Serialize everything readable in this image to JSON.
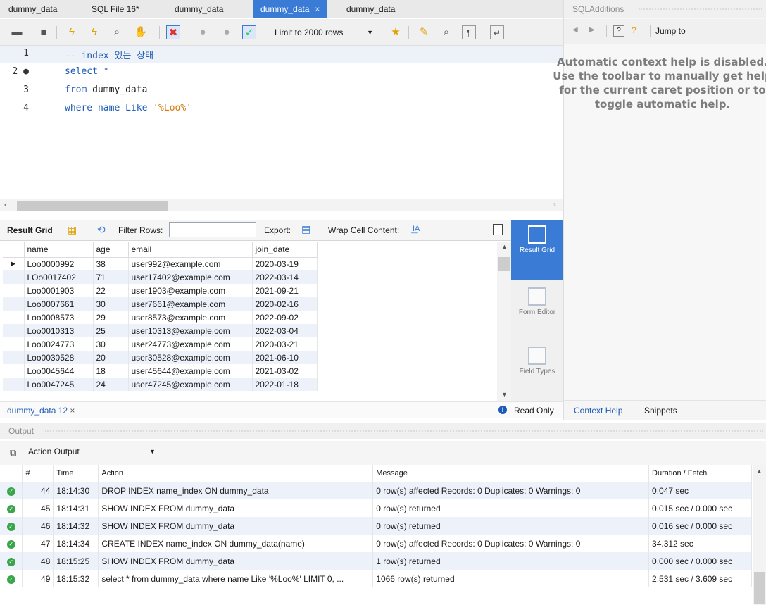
{
  "editor_tabs": [
    {
      "label": "dummy_data"
    },
    {
      "label": "SQL File 16*"
    },
    {
      "label": "dummy_data"
    },
    {
      "label": "dummy_data",
      "active": true
    },
    {
      "label": "dummy_data"
    }
  ],
  "toolbar": {
    "limit_label": "Limit to 2000 rows"
  },
  "editor": {
    "lines": [
      {
        "num": "1",
        "segments": [
          {
            "t": "-- index 있는 상태",
            "c": "cm"
          }
        ]
      },
      {
        "num": "2 ●",
        "segments": [
          {
            "t": "select *",
            "c": "kw"
          }
        ]
      },
      {
        "num": "3",
        "segments": [
          {
            "t": "from ",
            "c": "kw"
          },
          {
            "t": "dummy_data",
            "c": "plain"
          }
        ]
      },
      {
        "num": "4",
        "segments": [
          {
            "t": "where name Like ",
            "c": "kw"
          },
          {
            "t": "'%Loo%'",
            "c": "str"
          }
        ]
      }
    ]
  },
  "result_toolbar": {
    "result_grid_label": "Result Grid",
    "filter_label": "Filter Rows:",
    "filter_value": "",
    "export_label": "Export:",
    "wrap_label": "Wrap Cell Content:"
  },
  "result_grid": {
    "columns": [
      "name",
      "age",
      "email",
      "join_date"
    ],
    "rows": [
      [
        "Loo0000992",
        "38",
        "user992@example.com",
        "2020-03-19"
      ],
      [
        "LOo0017402",
        "71",
        "user17402@example.com",
        "2022-03-14"
      ],
      [
        "Loo0001903",
        "22",
        "user1903@example.com",
        "2021-09-21"
      ],
      [
        "Loo0007661",
        "30",
        "user7661@example.com",
        "2020-02-16"
      ],
      [
        "Loo0008573",
        "29",
        "user8573@example.com",
        "2022-09-02"
      ],
      [
        "Loo0010313",
        "25",
        "user10313@example.com",
        "2022-03-04"
      ],
      [
        "Loo0024773",
        "30",
        "user24773@example.com",
        "2020-03-21"
      ],
      [
        "Loo0030528",
        "20",
        "user30528@example.com",
        "2021-06-10"
      ],
      [
        "Loo0045644",
        "18",
        "user45644@example.com",
        "2021-03-02"
      ],
      [
        "Loo0047245",
        "24",
        "user47245@example.com",
        "2022-01-18"
      ]
    ]
  },
  "side_tools": [
    {
      "label": "Result Grid",
      "selected": true
    },
    {
      "label": "Form Editor"
    },
    {
      "label": "Field Types"
    }
  ],
  "result_status": {
    "tab_label": "dummy_data 12",
    "read_only": "Read Only"
  },
  "right_panel": {
    "title": "SQLAdditions",
    "jump_to": "Jump to",
    "help_text": "Automatic context help is disabled. Use the toolbar to manually get help for the current caret position or to toggle automatic help.",
    "tabs": [
      "Context Help",
      "Snippets"
    ]
  },
  "output": {
    "title": "Output",
    "selector": "Action Output",
    "columns": [
      "#",
      "Time",
      "Action",
      "Message",
      "Duration / Fetch"
    ],
    "rows": [
      [
        "44",
        "18:14:30",
        "DROP INDEX name_index ON dummy_data",
        "0 row(s) affected Records: 0  Duplicates: 0  Warnings: 0",
        "0.047 sec"
      ],
      [
        "45",
        "18:14:31",
        "SHOW INDEX FROM dummy_data",
        "0 row(s) returned",
        "0.015 sec / 0.000 sec"
      ],
      [
        "46",
        "18:14:32",
        "SHOW INDEX FROM dummy_data",
        "0 row(s) returned",
        "0.016 sec / 0.000 sec"
      ],
      [
        "47",
        "18:14:34",
        "CREATE INDEX name_index ON dummy_data(name)",
        "0 row(s) affected Records: 0  Duplicates: 0  Warnings: 0",
        "34.312 sec"
      ],
      [
        "48",
        "18:15:25",
        "SHOW INDEX FROM dummy_data",
        "1 row(s) returned",
        "0.000 sec / 0.000 sec"
      ],
      [
        "49",
        "18:15:32",
        "select * from dummy_data where name Like '%Loo%' LIMIT 0, ...",
        "1066 row(s) returned",
        "2.531 sec / 3.609 sec"
      ]
    ]
  }
}
